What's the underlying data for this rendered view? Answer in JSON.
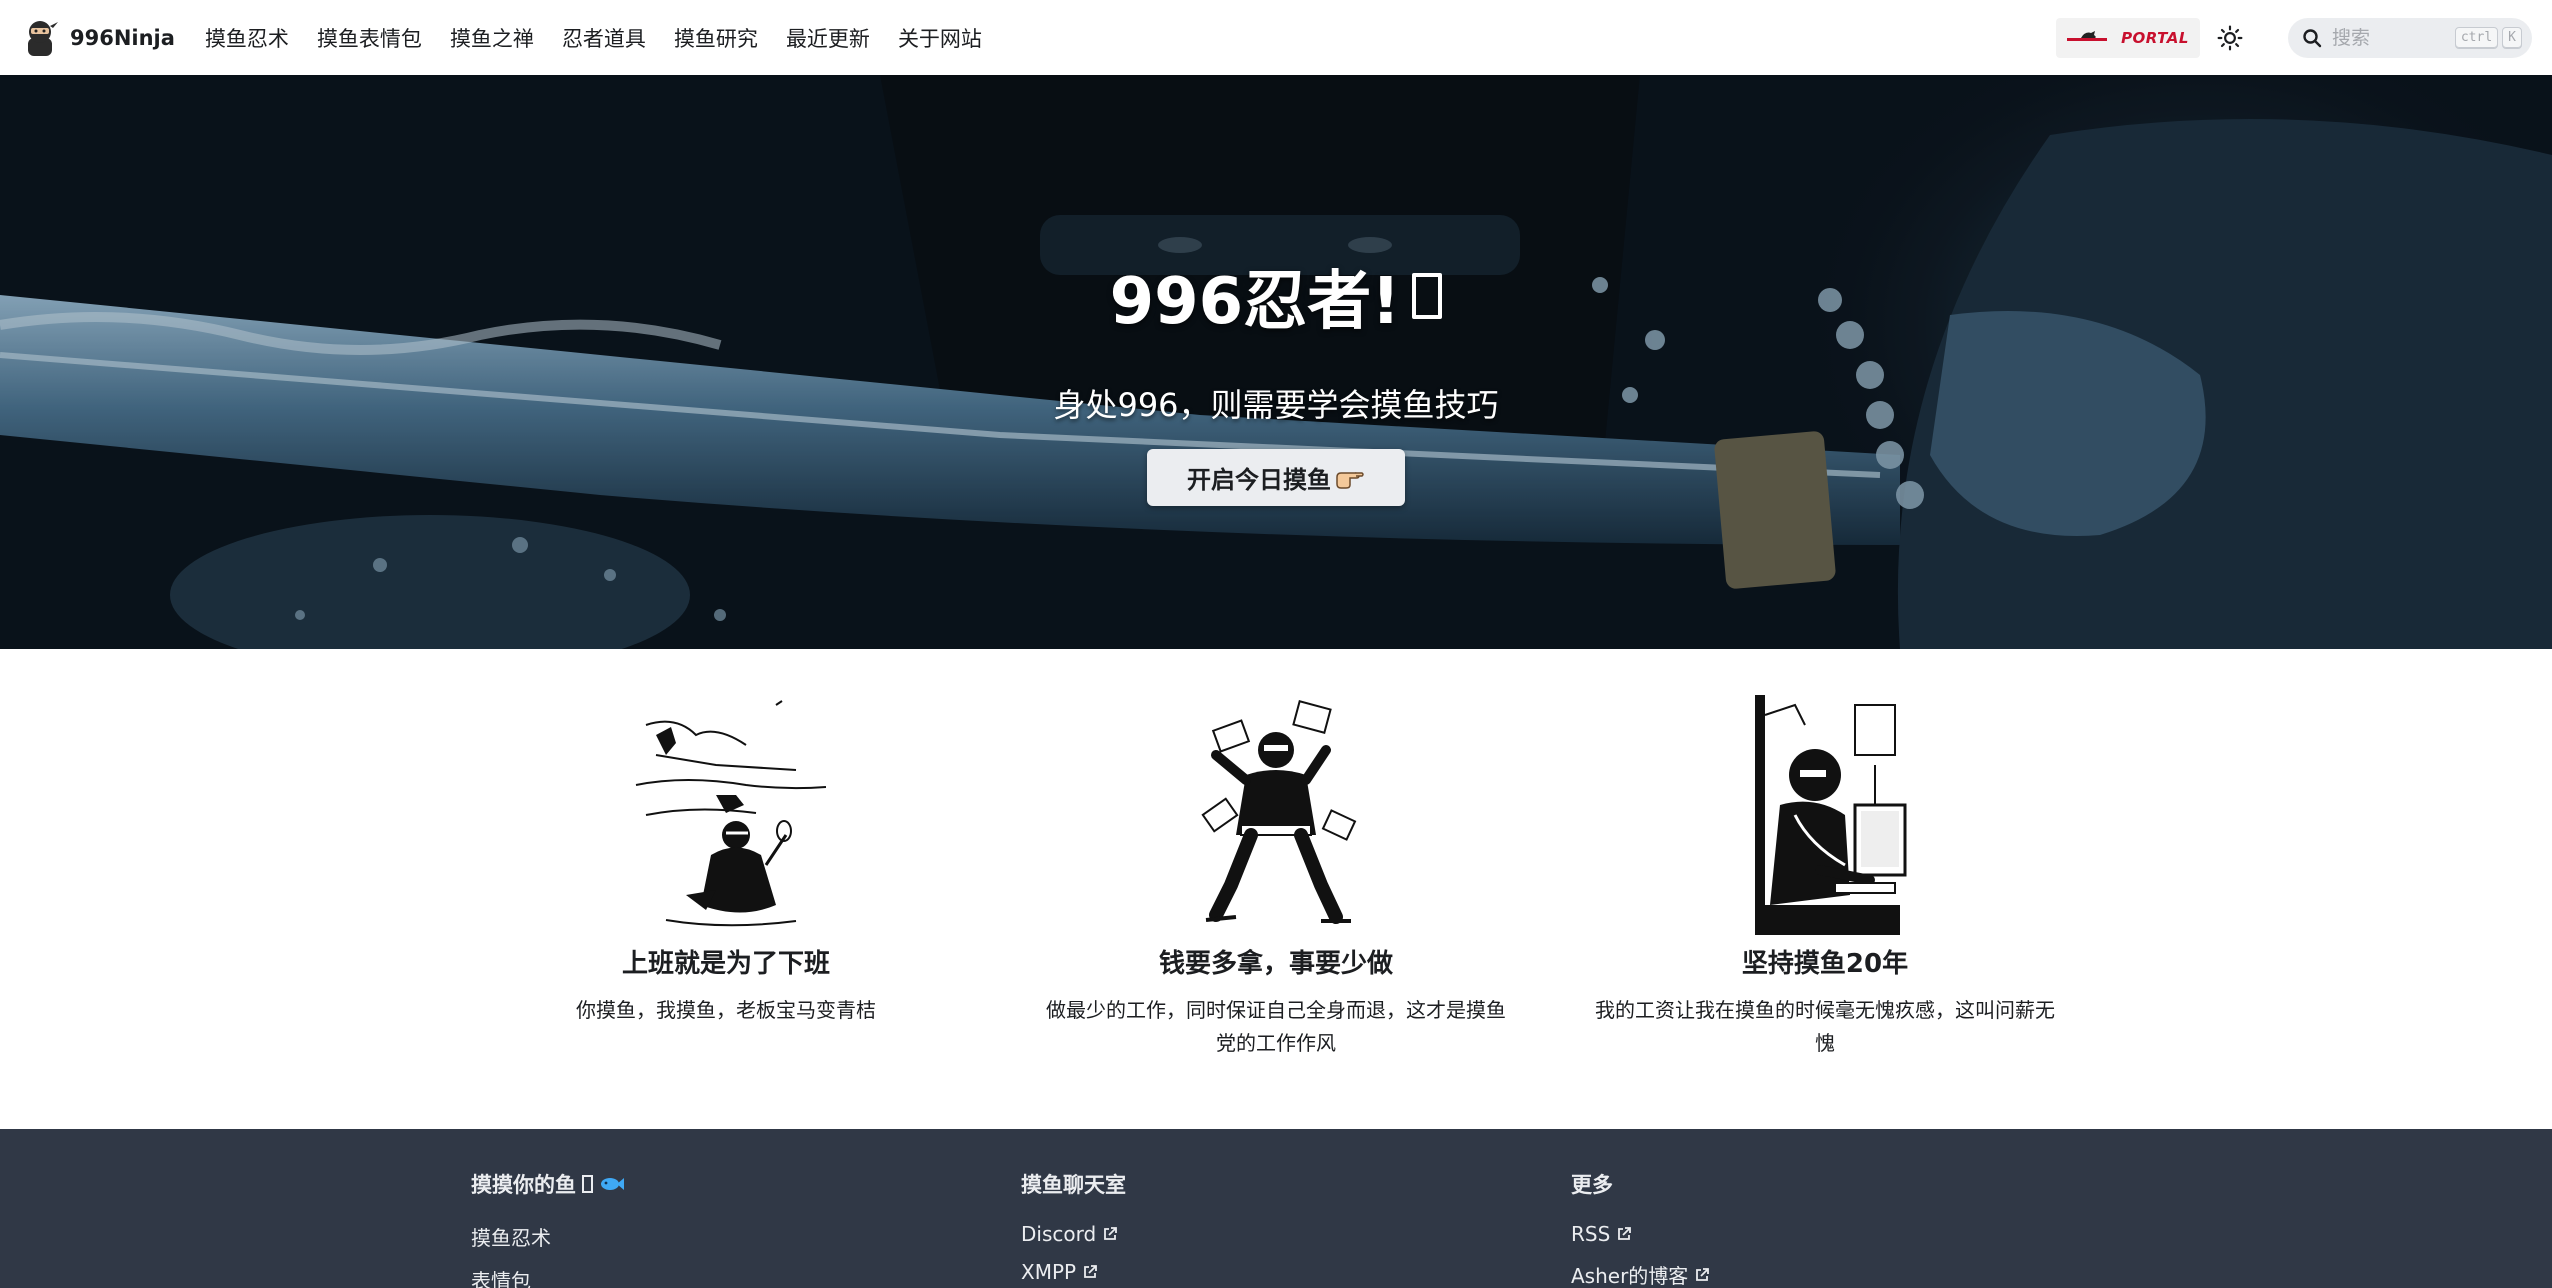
{
  "navbar": {
    "brand": "996Ninja",
    "items": [
      "摸鱼忍术",
      "摸鱼表情包",
      "摸鱼之禅",
      "忍者道具",
      "摸鱼研究",
      "最近更新",
      "关于网站"
    ],
    "portal_label": "PORTAL",
    "search": {
      "placeholder": "搜索",
      "kbd_ctrl": "ctrl",
      "kbd_k": "K"
    }
  },
  "hero": {
    "title": "996忍者!",
    "subtitle": "身处996，则需要学会摸鱼技巧",
    "cta_label": "开启今日摸鱼",
    "cta_emoji": "👉"
  },
  "features": [
    {
      "title": "上班就是为了下班",
      "desc": "你摸鱼，我摸鱼，老板宝马变青桔"
    },
    {
      "title": "钱要多拿，事要少做",
      "desc": "做最少的工作，同时保证自己全身而退，这才是摸鱼党的工作作风"
    },
    {
      "title": "坚持摸鱼20年",
      "desc": "我的工资让我在摸鱼的时候毫无愧疚感，这叫问薪无愧"
    }
  ],
  "footer": {
    "columns": [
      {
        "title": "摸摸你的鱼",
        "title_emoji": "🐟",
        "links": [
          "摸鱼忍术",
          "表情包"
        ]
      },
      {
        "title": "摸鱼聊天室",
        "links": [
          "Discord",
          "XMPP"
        ]
      },
      {
        "title": "更多",
        "links": [
          "RSS",
          "Asher的博客"
        ]
      }
    ]
  },
  "colors": {
    "footer_bg": "#303846",
    "portal_red": "#c8102e",
    "text": "#1c1e21"
  }
}
